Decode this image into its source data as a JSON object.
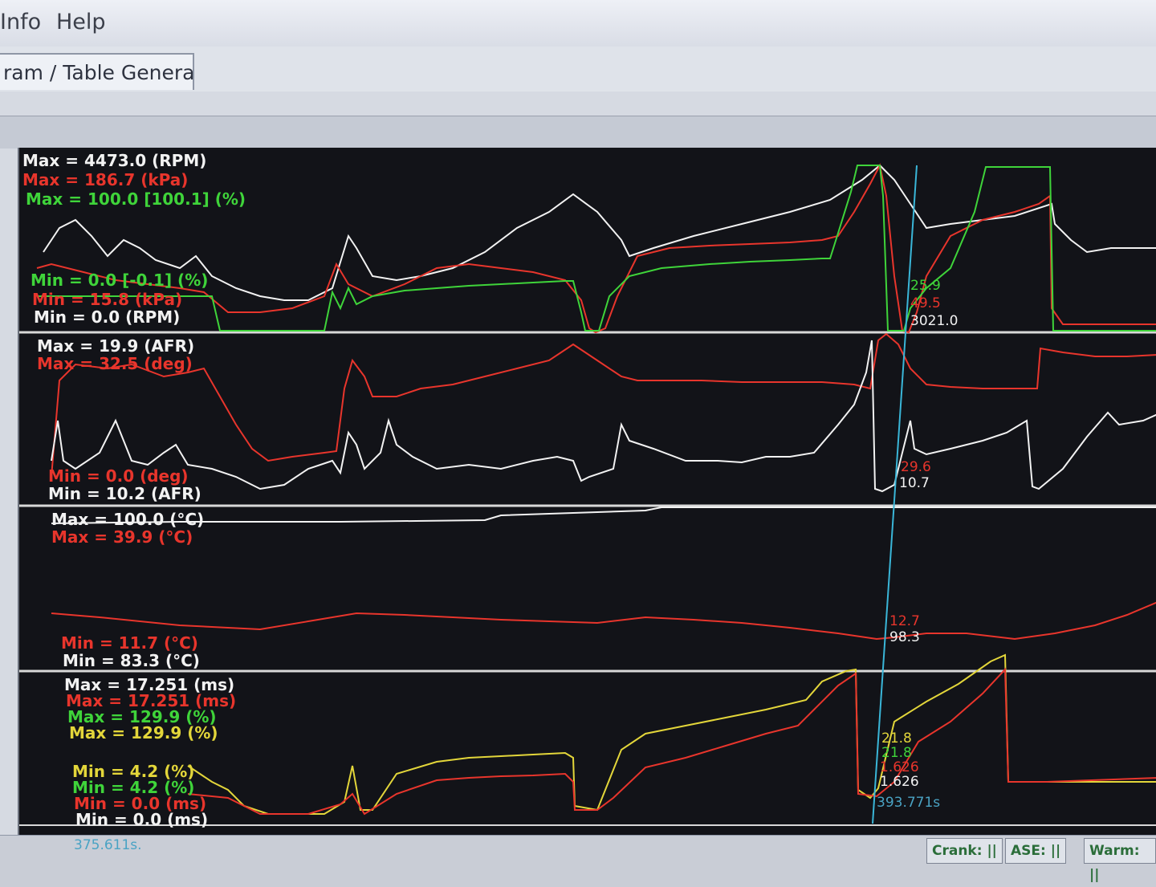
{
  "menu": {
    "info": "Info",
    "help": "Help"
  },
  "tab": {
    "label": "ram / Table Generator"
  },
  "colors": {
    "background": "#121318",
    "white": "#f2f2f2",
    "red": "#e8352c",
    "green": "#3fd43a",
    "yellow": "#e3d63a",
    "cursor": "#3ab6d8"
  },
  "panel1": {
    "labels": {
      "max_rpm": "Max = 4473.0 (RPM)",
      "max_kpa": "Max = 186.7 (kPa)",
      "max_pct": "Max = 100.0 [100.1] (%)",
      "min_pct": "Min = 0.0 [-0.1] (%)",
      "min_kpa": "Min = 15.8 (kPa)",
      "min_rpm": "Min = 0.0 (RPM)"
    },
    "cursor_values": {
      "green": "25.9",
      "red": "49.5",
      "white": "3021.0"
    }
  },
  "panel2": {
    "labels": {
      "max_afr": "Max = 19.9 (AFR)",
      "max_deg": "Max = 32.5 (deg)",
      "min_deg": "Min = 0.0 (deg)",
      "min_afr": "Min = 10.2 (AFR)"
    },
    "cursor_values": {
      "red": "29.6",
      "white": "10.7"
    }
  },
  "panel3": {
    "labels": {
      "max_white": "Max = 100.0 (°C)",
      "max_red": "Max = 39.9 (°C)",
      "min_red": "Min = 11.7 (°C)",
      "min_white": "Min = 83.3 (°C)"
    },
    "cursor_values": {
      "red": "12.7",
      "white": "98.3"
    }
  },
  "panel4": {
    "labels": {
      "max_ms_white": "Max = 17.251 (ms)",
      "max_ms_red": "Max = 17.251 (ms)",
      "max_pct_green": "Max = 129.9 (%)",
      "max_pct_yellow": "Max = 129.9 (%)",
      "min_pct_yellow": "Min = 4.2 (%)",
      "min_pct_green": "Min = 4.2 (%)",
      "min_ms_red": "Min = 0.0 (ms)",
      "min_ms_white": "Min = 0.0 (ms)"
    },
    "cursor_values": {
      "yellow": "21.8",
      "green": "21.8",
      "red": "1.626",
      "white": "1.626"
    }
  },
  "time": {
    "start": "375.611s.",
    "cursor": "393.771s"
  },
  "status": {
    "crank": "Crank: ||",
    "ase": "ASE: ||",
    "warm": "Warm: ||"
  }
}
